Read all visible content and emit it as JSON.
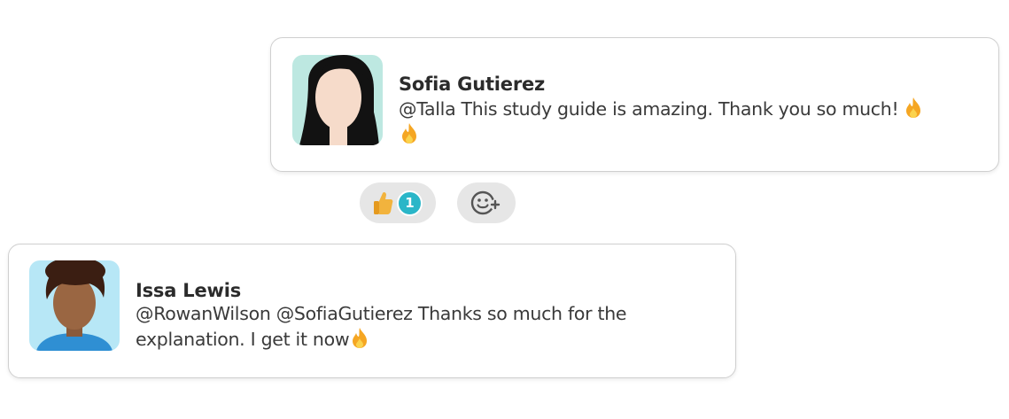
{
  "comments": [
    {
      "author": "Sofia Gutierez",
      "message": "@Talla This study guide is amazing. Thank you so much!",
      "emoji": [
        "fire-icon",
        "fire-icon"
      ],
      "reactions": {
        "like_icon": "thumbs-up-icon",
        "like_count": "1",
        "add_icon": "add-emoji-icon"
      }
    },
    {
      "author": "Issa Lewis",
      "message": "@RowanWilson @SofiaGutierez Thanks so much for the explanation. I get it now",
      "emoji": [
        "fire-icon"
      ]
    }
  ],
  "colors": {
    "badge": "#2ab6c8",
    "pill": "#e6e6e6",
    "flame": "#f5a623",
    "avatar_sofia_bg": "#bde8e1",
    "avatar_issa_bg": "#b7e7f6"
  }
}
